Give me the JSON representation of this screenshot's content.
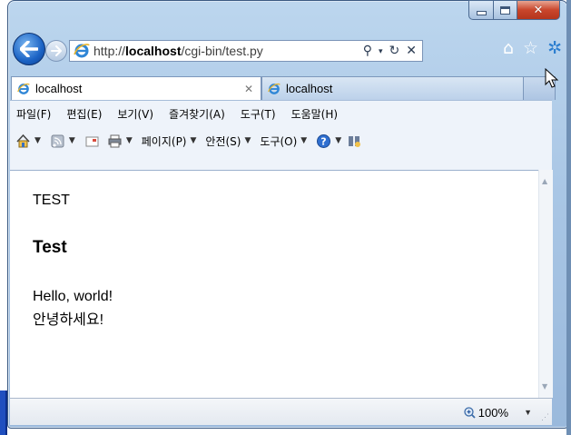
{
  "address_bar": {
    "url_prefix": "http://",
    "url_host": "localhost",
    "url_path": "/cgi-bin/test.py"
  },
  "tabs": [
    {
      "label": "localhost",
      "active": true
    },
    {
      "label": "localhost",
      "active": false
    }
  ],
  "menu": {
    "items": [
      "파일(F)",
      "편집(E)",
      "보기(V)",
      "즐겨찾기(A)",
      "도구(T)",
      "도움말(H)"
    ]
  },
  "command_bar": {
    "page_label": "페이지(P)",
    "safety_label": "안전(S)",
    "tools_label": "도구(O)"
  },
  "page": {
    "line1": "TEST",
    "heading": "Test",
    "text1": "Hello, world!",
    "text2": "안녕하세요!"
  },
  "status_bar": {
    "zoom": "100%"
  },
  "colors": {
    "frame": "#a9c6e5",
    "close_button": "#c9462c",
    "back_button": "#1b63c5"
  },
  "icons": [
    "back-arrow-icon",
    "forward-arrow-icon",
    "ie-logo-icon",
    "search-icon",
    "refresh-icon",
    "stop-icon",
    "home-icon",
    "favorites-star-icon",
    "gear-icon",
    "feeds-icon",
    "mail-icon",
    "print-icon",
    "help-icon",
    "research-icon",
    "zoom-icon"
  ]
}
